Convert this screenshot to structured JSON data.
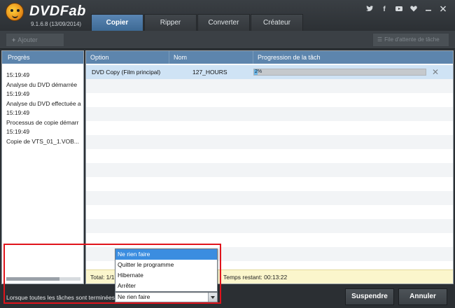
{
  "header": {
    "brand": "DVDFab",
    "version": "9.1.6.8 (13/09/2014)",
    "tabs": [
      {
        "label": "Copier",
        "active": true
      },
      {
        "label": "Ripper",
        "active": false
      },
      {
        "label": "Converter",
        "active": false
      },
      {
        "label": "Créateur",
        "active": false
      }
    ],
    "social_icons": [
      "twitter-icon",
      "facebook-icon",
      "youtube-icon",
      "heart-icon",
      "minimize-icon",
      "close-icon"
    ]
  },
  "toolbar": {
    "add_label": "Ajouter",
    "queue_label": "File d'attente de tâche"
  },
  "left_panel": {
    "header": "Progrès",
    "log": [
      "15:19:49",
      "Analyse du DVD démarrée",
      "15:19:49",
      "Analyse du DVD effectuée a",
      "15:19:49",
      "Processus de copie démarr",
      "15:19:49",
      "Copie de  VTS_01_1.VOB..."
    ]
  },
  "table": {
    "columns": [
      "Option",
      "Nom",
      "Progression de la tâch"
    ],
    "rows": [
      {
        "option": "DVD Copy (Film principal)",
        "name": "127_HOURS",
        "progress_percent": 2,
        "progress_label": "2%"
      }
    ],
    "total": "Total: 1/1",
    "remaining": "Temps restant:  00:13:22"
  },
  "bottom": {
    "when_label": "Lorsque toutes les tâches sont terminées:",
    "select_value": "Ne rien faire",
    "options": [
      "Ne rien faire",
      "Quitter le programme",
      "Hibernate",
      "Arrêter"
    ],
    "selected_option": "Ne rien faire",
    "suspend_label": "Suspendre",
    "cancel_label": "Annuler"
  },
  "colors": {
    "accent": "#5d85ad",
    "progress": "#6cb7e8",
    "highlight": "#e0141c",
    "footer": "#fbf6cc"
  }
}
